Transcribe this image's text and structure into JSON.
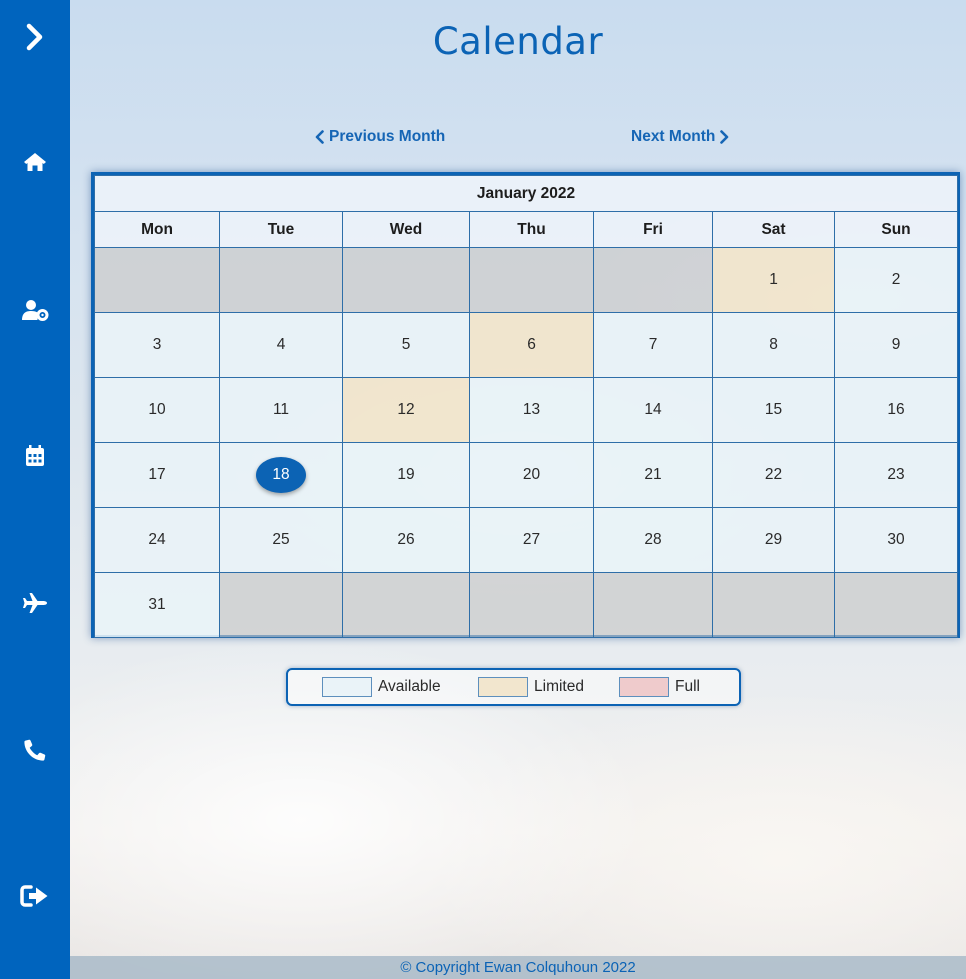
{
  "sidebar": {
    "background": "#0064be",
    "items": [
      {
        "icon": "chevron-right-icon",
        "name": "expand-sidebar"
      },
      {
        "icon": "home-icon",
        "name": "home"
      },
      {
        "icon": "user-settings-icon",
        "name": "account"
      },
      {
        "icon": "calendar-icon",
        "name": "calendar"
      },
      {
        "icon": "plane-icon",
        "name": "flights"
      },
      {
        "icon": "phone-icon",
        "name": "contact"
      },
      {
        "icon": "sign-out-icon",
        "name": "logout"
      }
    ]
  },
  "page": {
    "title": "Calendar",
    "accent": "#0b63b5"
  },
  "nav": {
    "prev_label": "Previous Month",
    "next_label": "Next Month"
  },
  "calendar": {
    "month_label": "January 2022",
    "weekdays": [
      "Mon",
      "Tue",
      "Wed",
      "Thu",
      "Fri",
      "Sat",
      "Sun"
    ],
    "today": 18,
    "weeks": [
      [
        {
          "day": "",
          "status": "empty"
        },
        {
          "day": "",
          "status": "empty"
        },
        {
          "day": "",
          "status": "empty"
        },
        {
          "day": "",
          "status": "empty"
        },
        {
          "day": "",
          "status": "empty"
        },
        {
          "day": "1",
          "status": "limited"
        },
        {
          "day": "2",
          "status": "available"
        }
      ],
      [
        {
          "day": "3",
          "status": "available"
        },
        {
          "day": "4",
          "status": "available"
        },
        {
          "day": "5",
          "status": "available"
        },
        {
          "day": "6",
          "status": "limited"
        },
        {
          "day": "7",
          "status": "available"
        },
        {
          "day": "8",
          "status": "available"
        },
        {
          "day": "9",
          "status": "available"
        }
      ],
      [
        {
          "day": "10",
          "status": "available"
        },
        {
          "day": "11",
          "status": "available"
        },
        {
          "day": "12",
          "status": "limited"
        },
        {
          "day": "13",
          "status": "available"
        },
        {
          "day": "14",
          "status": "available"
        },
        {
          "day": "15",
          "status": "available"
        },
        {
          "day": "16",
          "status": "available"
        }
      ],
      [
        {
          "day": "17",
          "status": "available"
        },
        {
          "day": "18",
          "status": "available"
        },
        {
          "day": "19",
          "status": "available"
        },
        {
          "day": "20",
          "status": "available"
        },
        {
          "day": "21",
          "status": "available"
        },
        {
          "day": "22",
          "status": "available"
        },
        {
          "day": "23",
          "status": "available"
        }
      ],
      [
        {
          "day": "24",
          "status": "available"
        },
        {
          "day": "25",
          "status": "available"
        },
        {
          "day": "26",
          "status": "available"
        },
        {
          "day": "27",
          "status": "available"
        },
        {
          "day": "28",
          "status": "available"
        },
        {
          "day": "29",
          "status": "available"
        },
        {
          "day": "30",
          "status": "available"
        }
      ],
      [
        {
          "day": "31",
          "status": "available"
        },
        {
          "day": "",
          "status": "empty"
        },
        {
          "day": "",
          "status": "empty"
        },
        {
          "day": "",
          "status": "empty"
        },
        {
          "day": "",
          "status": "empty"
        },
        {
          "day": "",
          "status": "empty"
        },
        {
          "day": "",
          "status": "empty"
        }
      ]
    ],
    "status_colors": {
      "available": "#e8f2f7",
      "limited": "#f1e4c8",
      "full": "#eec6c8",
      "empty": "#c4c4c4",
      "today": "#0c63b4"
    }
  },
  "legend": {
    "items": [
      {
        "label": "Available",
        "status": "available"
      },
      {
        "label": "Limited",
        "status": "limited"
      },
      {
        "label": "Full",
        "status": "full"
      }
    ]
  },
  "footer": {
    "text": "© Copyright Ewan Colquhoun 2022"
  }
}
